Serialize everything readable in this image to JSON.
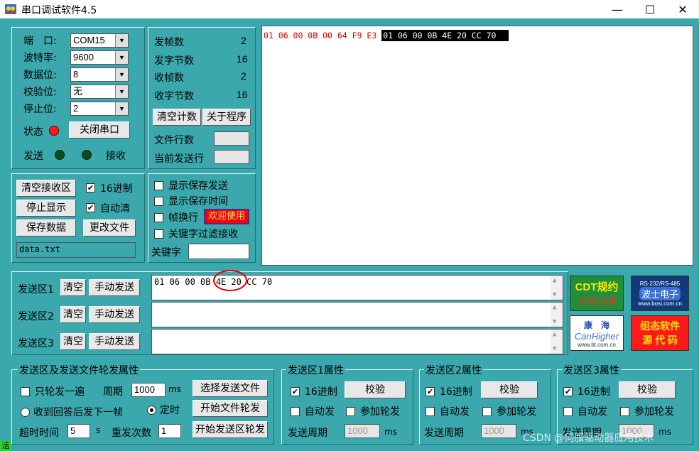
{
  "window": {
    "title": "串口调试软件4.5"
  },
  "port": {
    "port_label": "端　口:",
    "port_value": "COM15",
    "baud_label": "波特率:",
    "baud_value": "9600",
    "data_label": "数据位:",
    "data_value": "8",
    "parity_label": "校验位:",
    "parity_value": "无",
    "stop_label": "停止位:",
    "stop_value": "2",
    "status_label": "状态",
    "close_button": "关闭串口",
    "send_label": "发送",
    "recv_label": "接收"
  },
  "stats": {
    "sent_frames_label": "发帧数",
    "sent_frames": "2",
    "sent_bytes_label": "发字节数",
    "sent_bytes": "16",
    "recv_frames_label": "收帧数",
    "recv_frames": "2",
    "recv_bytes_label": "收字节数",
    "recv_bytes": "16",
    "clear_count": "清空计数",
    "about": "关于程序",
    "file_lines_label": "文件行数",
    "current_line_label": "当前发送行"
  },
  "recv_controls": {
    "clear_recv": "清空接收区",
    "hex": "16进制",
    "stop_display": "停止显示",
    "auto_clear": "自动清",
    "save_data": "保存数据",
    "change_file": "更改文件",
    "filename": "data.txt"
  },
  "display_opts": {
    "show_save_send": "显示保存发送",
    "show_save_time": "显示保存时间",
    "frame_newline": "帧换行",
    "welcome": "欢迎使用",
    "keyword_filter": "关键字过滤接收",
    "keyword_label": "关键字"
  },
  "recv_text": {
    "sent": "01 06 00 0B 00 64 F9 E3",
    "received": "01 06 00 0B 4E 20 CC 70"
  },
  "send_area": {
    "rows": [
      {
        "label": "发送区1",
        "clear": "清空",
        "manual": "手动发送",
        "text": "01 06 00 0B 4E 20 CC 70"
      },
      {
        "label": "发送区2",
        "clear": "清空",
        "manual": "手动发送",
        "text": ""
      },
      {
        "label": "发送区3",
        "clear": "清空",
        "manual": "手动发送",
        "text": ""
      }
    ]
  },
  "ads": {
    "cdt_line1": "CDT规约",
    "cdt_line2": "分析仿真",
    "bosi_top": "RS-232/RS-485",
    "bosi_name": "波士电子",
    "bosi_url": "www.bosi.com.cn",
    "kanghai_cn": "康　海",
    "kanghai_en": "CanHigher",
    "kanghai_url": "www.bt.com.cn",
    "zutai_line1": "组态软件",
    "zutai_line2": "源 代 码"
  },
  "rotation": {
    "title": "发送区及发送文件轮发属性",
    "only_once": "只轮发一遍",
    "period_label": "周期",
    "period_value": "1000",
    "ms": "ms",
    "select_file": "选择发送文件",
    "reply_next": "收到回答后发下一帧",
    "timed": "定时",
    "start_file_rotate": "开始文件轮发",
    "timeout_label": "超时时间",
    "timeout_value": "5",
    "s": "s",
    "resend_label": "重发次数",
    "resend_value": "1",
    "start_area_rotate": "开始发送区轮发"
  },
  "props": [
    {
      "title": "发送区1属性",
      "hex": "16进制",
      "check": "校验",
      "auto": "自动发",
      "join": "参加轮发",
      "period_label": "发送周期",
      "period": "1000",
      "ms": "ms"
    },
    {
      "title": "发送区2属性",
      "hex": "16进制",
      "check": "校验",
      "auto": "自动发",
      "join": "参加轮发",
      "period_label": "发送周期",
      "period": "1000",
      "ms": "ms"
    },
    {
      "title": "发送区3属性",
      "hex": "16进制",
      "check": "校验",
      "auto": "自动发",
      "join": "参加轮发",
      "period_label": "发送周期",
      "period": "1000",
      "ms": "ms"
    }
  ],
  "statusbar": {
    "indicator": "活"
  },
  "watermark": "CSDN @伺服驱动器应用技术"
}
